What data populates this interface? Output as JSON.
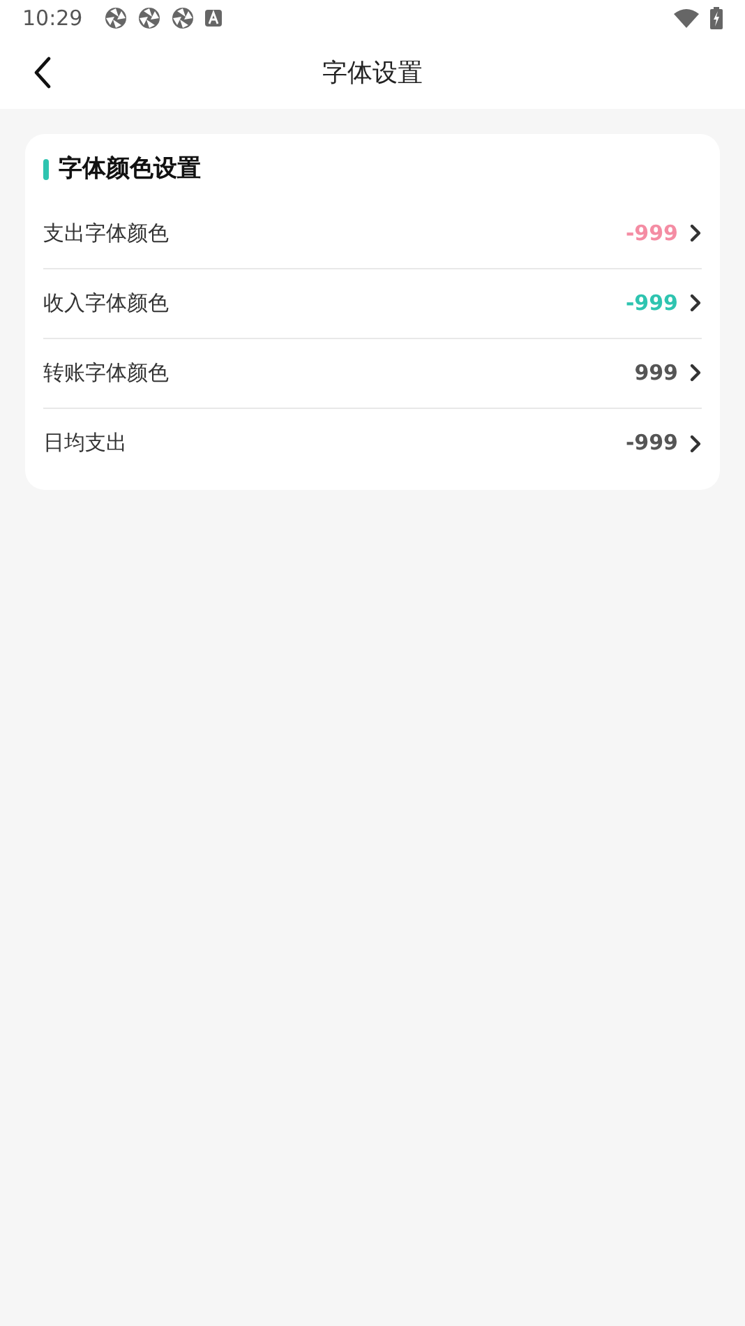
{
  "status_bar": {
    "time": "10:29"
  },
  "header": {
    "title": "字体设置"
  },
  "section": {
    "title": "字体颜色设置",
    "items": [
      {
        "label": "支出字体颜色",
        "value": "-999",
        "color": "#f48ca3"
      },
      {
        "label": "收入字体颜色",
        "value": "-999",
        "color": "#2ec4b0"
      },
      {
        "label": "转账字体颜色",
        "value": "999",
        "color": "#555555"
      },
      {
        "label": "日均支出",
        "value": "-999",
        "color": "#555555"
      }
    ]
  }
}
